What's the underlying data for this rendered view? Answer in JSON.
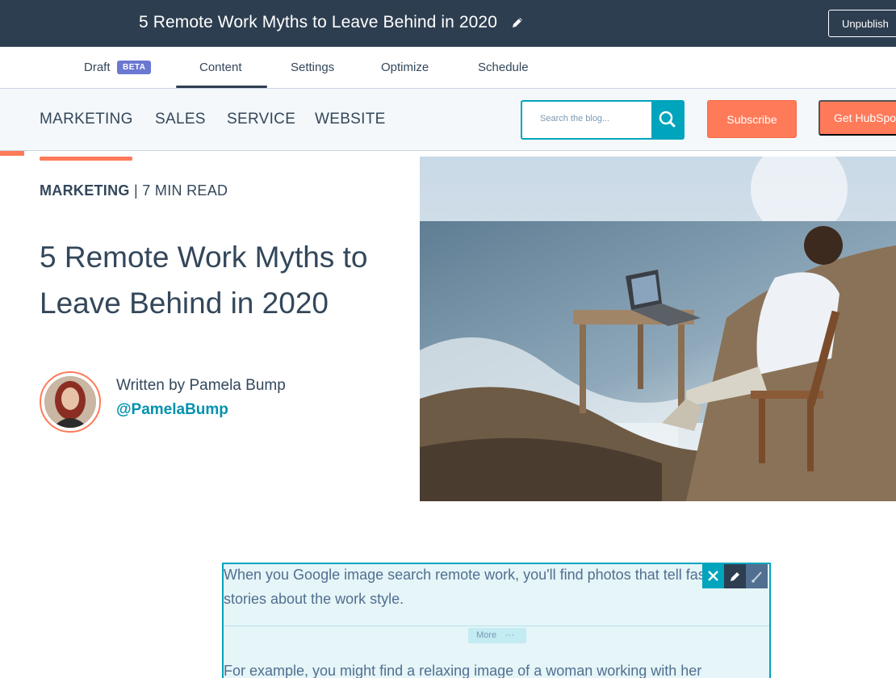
{
  "editor": {
    "title": "5 Remote Work Myths to Leave Behind in 2020",
    "unpublish_label": "Unpublish",
    "tabs": [
      {
        "label": "Draft",
        "badge": "BETA"
      },
      {
        "label": "Content",
        "active": true
      },
      {
        "label": "Settings"
      },
      {
        "label": "Optimize"
      },
      {
        "label": "Schedule"
      }
    ]
  },
  "blog_nav": {
    "links": [
      "MARKETING",
      "SALES",
      "SERVICE",
      "WEBSITE"
    ],
    "search_placeholder": "Search the blog...",
    "subscribe_label": "Subscribe",
    "get_hubspot_label": "Get HubSpot"
  },
  "article": {
    "category": "MARKETING",
    "read_time": "7 MIN READ",
    "headline": "5 Remote Work Myths to Leave Behind in 2020",
    "byline": "Written by Pamela Bump",
    "author_handle": "@PamelaBump",
    "paragraph_1": "When you Google image search remote work, you'll find photos that tell fascinating stories about the work style.",
    "more_label": "More",
    "paragraph_2": "For example, you might find a relaxing image of a woman working with her"
  },
  "colors": {
    "topbar": "#2d3e50",
    "accent": "#ff7a59",
    "teal": "#00a4bd",
    "text": "#33475b",
    "link": "#0091ae"
  },
  "icons": {
    "title_edit": "pencil-icon",
    "search": "search-icon",
    "module_delete": "close-icon",
    "module_edit": "pencil-icon",
    "module_style": "brush-icon"
  }
}
